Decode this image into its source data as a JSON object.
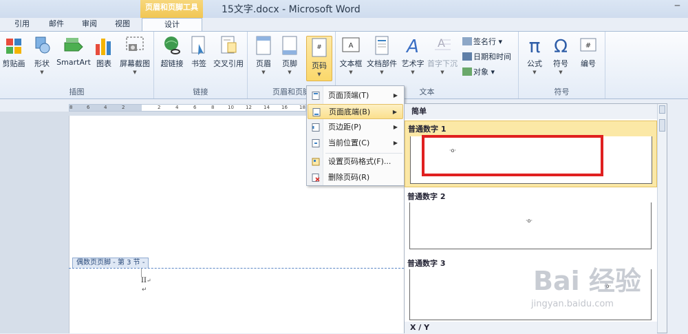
{
  "window": {
    "context_tab_title": "页眉和页脚工具",
    "title": "15文字.docx - Microsoft Word",
    "control": "‒"
  },
  "tabs": [
    "引用",
    "邮件",
    "审阅",
    "视图",
    "设计"
  ],
  "ribbon": {
    "groups": {
      "illustrations": "插图",
      "links": "链接",
      "header_footer": "页眉和页脚",
      "text": "文本",
      "symbols": "符号"
    },
    "buttons": {
      "clipart": "剪贴画",
      "shapes": "形状",
      "smartart": "SmartArt",
      "chart": "图表",
      "screenshot": "屏幕截图",
      "hyperlink": "超链接",
      "bookmark": "书签",
      "crossref": "交叉引用",
      "header": "页眉",
      "footer": "页脚",
      "pagenum": "页码",
      "textbox": "文本框",
      "docparts": "文档部件",
      "wordart": "艺术字",
      "dropcap": "首字下沉",
      "equation": "公式",
      "symbol": "符号",
      "number": "编号"
    },
    "small": {
      "signature": "签名行",
      "datetime": "日期和时间",
      "object": "对象"
    }
  },
  "ruler": [
    "8",
    "6",
    "4",
    "2",
    "2",
    "4",
    "6",
    "8",
    "10",
    "12",
    "14",
    "16",
    "18"
  ],
  "document": {
    "footer_tag": "偶数页页脚 - 第 3 节 -",
    "page_num_text": "II",
    "para_mark": "↵",
    "enter_mark": "↵"
  },
  "menu": {
    "items": [
      {
        "label": "页面顶端(T)"
      },
      {
        "label": "页面底端(B)"
      },
      {
        "label": "页边距(P)"
      },
      {
        "label": "当前位置(C)"
      },
      {
        "label": "设置页码格式(F)..."
      },
      {
        "label": "删除页码(R)"
      }
    ]
  },
  "gallery": {
    "section_head": "简单",
    "items": [
      {
        "label": "普通数字 1"
      },
      {
        "label": "普通数字 2"
      },
      {
        "label": "普通数字 3"
      }
    ],
    "next_section": "X / Y"
  },
  "watermark": {
    "text": "Bai 经验",
    "sub": "jingyan.baidu.com"
  },
  "colors": {
    "accent": "#f1c653",
    "highlight": "#fbe8a6",
    "red_box": "#e02020"
  }
}
